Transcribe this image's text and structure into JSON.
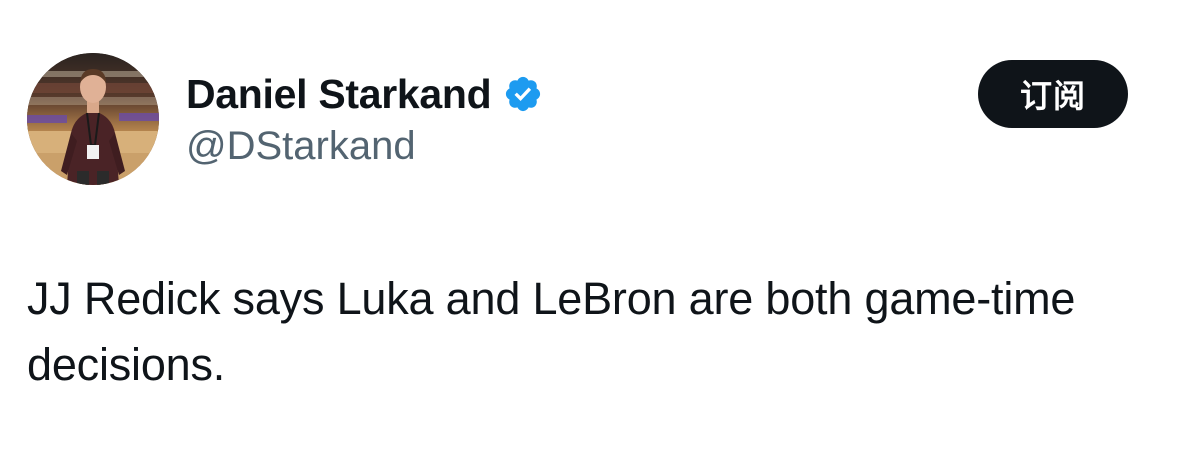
{
  "author": {
    "display_name": "Daniel Starkand",
    "handle": "@DStarkand",
    "verified": true,
    "avatar_icon": "profile-photo"
  },
  "actions": {
    "subscribe_label": "订阅"
  },
  "tweet": {
    "text": "JJ Redick says Luka and LeBron are both game-time decisions."
  },
  "colors": {
    "text_primary": "#0f1419",
    "text_secondary": "#536471",
    "verified_blue": "#1d9bf0",
    "button_bg": "#0f1419",
    "button_text": "#ffffff",
    "background": "#ffffff"
  }
}
